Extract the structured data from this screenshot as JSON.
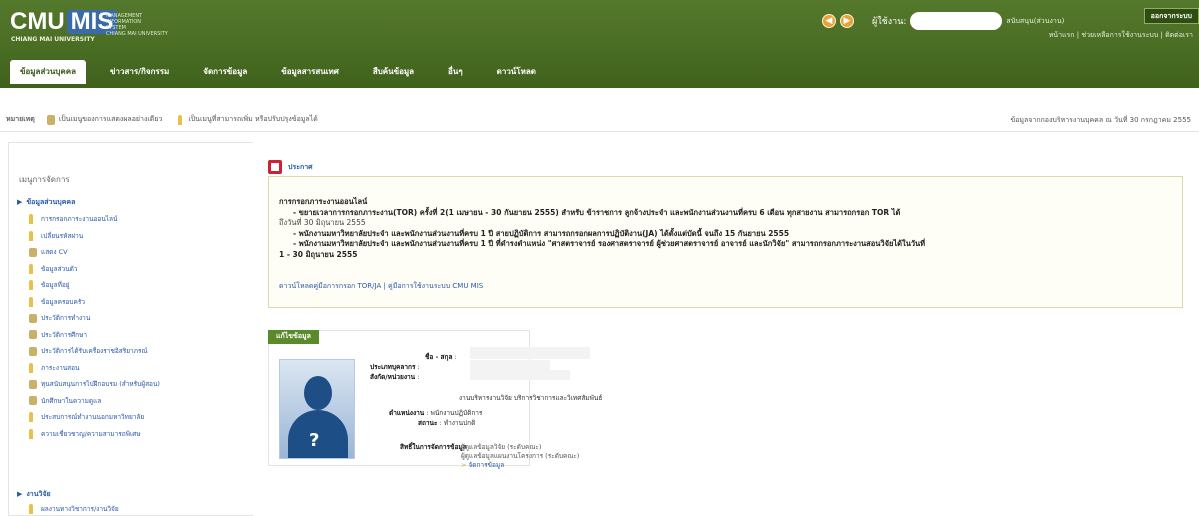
{
  "header": {
    "logo_cmu": "CMU",
    "logo_mis": "MIS",
    "logo_sub": "CHIANG MAI UNIVERSITY",
    "logo_side": [
      "MANAGEMENT",
      "INFORMATION",
      "SYSTEM",
      "CHIANG MAI UNIVERSITY"
    ],
    "user_label": "ผู้ใช้งาน:",
    "user_name": "สนับสนุน(ส่วนงาน)",
    "logout_label": "ออกจากระบบ",
    "links": "หน้าแรก  |  ช่วยเหลือการใช้งานระบบ  |  ติดต่อเรา"
  },
  "tabs": [
    {
      "label": "ข้อมูลส่วนบุคคล"
    },
    {
      "label": "ข่าวสาร/กิจกรรม"
    },
    {
      "label": "จัดการข้อมูล"
    },
    {
      "label": "ข้อมูลสารสนเทศ"
    },
    {
      "label": "สืบค้นข้อมูล"
    },
    {
      "label": "อื่นๆ"
    },
    {
      "label": "ดาวน์โหลด"
    }
  ],
  "infobar": {
    "label": "หมายเหตุ",
    "lock_note": "เป็นเมนูของการแสดงผลอย่างเดียว",
    "pin_note": "เป็นเมนูที่สามารถเพิ่ม หรือปรับปรุงข้อมูลได้",
    "right_note": "ข้อมูลจากกองบริหารงานบุคคล ณ วันที่ 30 กรกฎาคม 2555"
  },
  "sidebar": {
    "heading": "เมนูการจัดการ",
    "group1": "ข้อมูลส่วนบุคคล",
    "group2": "งานวิจัย",
    "items": [
      {
        "label": "การกรอกภาระงานออนไลน์",
        "icon": "pin"
      },
      {
        "label": "เปลี่ยนรหัสผ่าน",
        "icon": "pin"
      },
      {
        "label": "แสดง CV",
        "icon": "lock"
      },
      {
        "label": "ข้อมูลส่วนตัว",
        "icon": "pin"
      },
      {
        "label": "ข้อมูลที่อยู่",
        "icon": "pin"
      },
      {
        "label": "ข้อมูลครอบครัว",
        "icon": "pin"
      },
      {
        "label": "ประวัติการทำงาน",
        "icon": "lock"
      },
      {
        "label": "ประวัติการศึกษา",
        "icon": "lock"
      },
      {
        "label": "ประวัติการได้รับเครื่องราชอิสริยาภรณ์",
        "icon": "lock"
      },
      {
        "label": "ภาระงานสอน",
        "icon": "pin"
      },
      {
        "label": "ทุนสนับสนุนการไปฝึกอบรม (สำหรับผู้สอน)",
        "icon": "lock"
      },
      {
        "label": "นักศึกษาในความดูแล",
        "icon": "lock"
      },
      {
        "label": "ประสบการณ์ทำงานนอกมหาวิทยาลัย",
        "icon": "pin"
      },
      {
        "label": "ความเชี่ยวชาญ/ความสามารถพิเศษ",
        "icon": "pin"
      }
    ],
    "research_item": "ผลงานทางวิชาการ/งานวิจัย"
  },
  "announcement": {
    "title": "ประกาศ",
    "head": "การกรอกภาระงานออนไลน์",
    "lines": [
      "- ขยายเวลาการกรอกภาระงาน(TOR) ครั้งที่ 2(1 เมษายน - 30 กันยายน 2555) สำหรับ ข้าราชการ ลูกจ้างประจำ และพนักงานส่วนงานที่ครบ 6 เดือน ทุกสายงาน สามารถกรอก TOR ได้",
      "ถึงวันที่ 30 มิถุนายน 2555",
      "- พนักงานมหาวิทยาลัยประจำ และพนักงานส่วนงานที่ครบ 1 ปี สายปฏิบัติการ สามารถกรอกผลการปฏิบัติงาน(JA) ได้ตั้งแต่บัดนี้ จนถึง 15 กันยายน 2555",
      "- พนักงานมหาวิทยาลัยประจำ และพนักงานส่วนงานที่ครบ 1 ปี ที่ดำรงตำแหน่ง \"ศาสตราจารย์ รองศาสตราจารย์ ผู้ช่วยศาสตราจารย์ อาจารย์ และนักวิจัย\" สามารถกรอกภาระงานสอนวิจัยได้ในวันที่",
      "1 - 30 มิถุนายน 2555"
    ],
    "links": "ดาวน์โหลดคู่มือการกรอก TOR/JA  |  คู่มือการใช้งานระบบ CMU MIS"
  },
  "profile": {
    "tab": "แก้ไขข้อมูล",
    "labels": {
      "name": "ชื่อ - สกุล",
      "type": "ประเภทบุคลากร",
      "dept": "สังกัด/หน่วยงาน",
      "unit": "งานบริหารงานวิจัย บริการวิชาการและวิเทศสัมพันธ์",
      "position": "ตำแหน่งงาน",
      "position_val": "พนักงานปฏิบัติการ",
      "status": "สถานะ",
      "status_val": "ทำงานปกติ"
    },
    "rights_label": "สิทธิ์ในการจัดการข้อมูล",
    "rights": [
      "ผู้ดูแลข้อมูลวิจัย (ระดับคณะ)",
      "ผู้ดูแลข้อมูลแผนงานโครงการ (ระดับคณะ)"
    ],
    "manage_link": "จัดการข้อมูล"
  }
}
